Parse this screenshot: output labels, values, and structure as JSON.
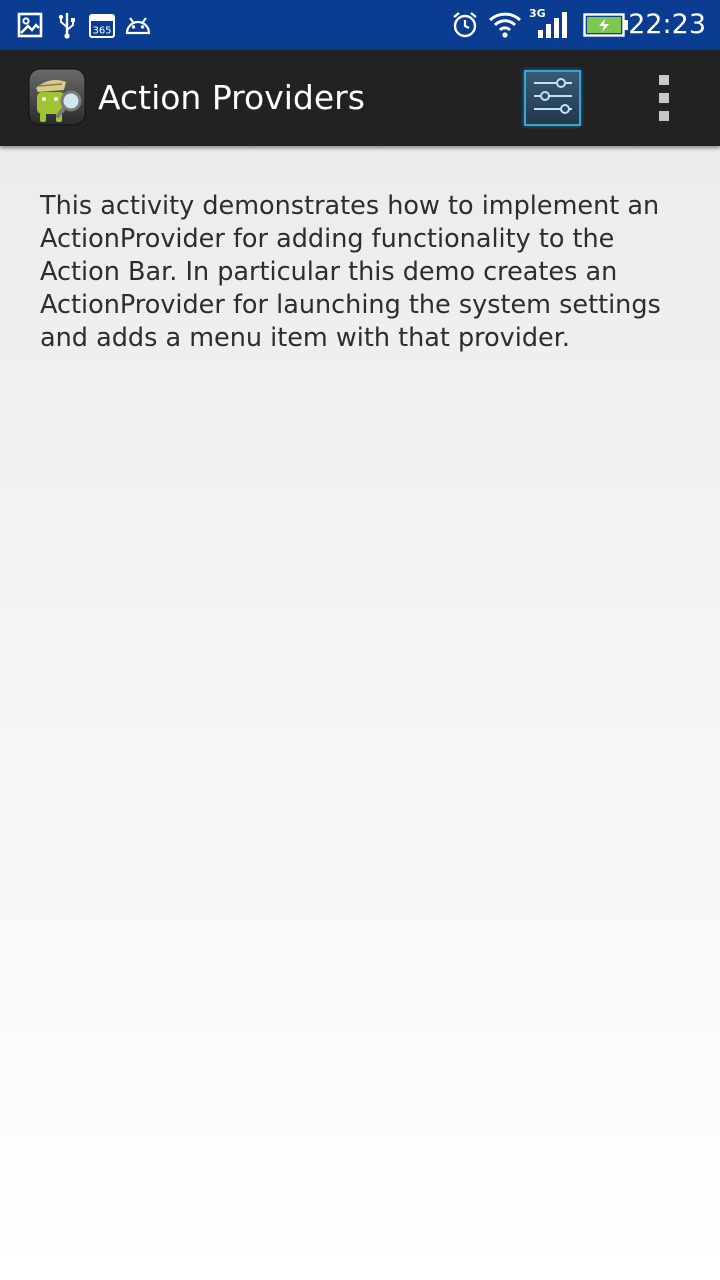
{
  "status_bar": {
    "time": "22:23",
    "network_type": "3G",
    "calendar_label": "365",
    "icons": {
      "left": [
        "image-notification-icon",
        "usb-icon",
        "calendar-icon",
        "android-debug-icon"
      ],
      "right": [
        "alarm-icon",
        "wifi-icon",
        "signal-icon",
        "battery-icon"
      ]
    }
  },
  "action_bar": {
    "title": "Action Providers",
    "app_icon": "api-demos-icon",
    "actions": [
      "settings-sliders-icon",
      "overflow-menu-icon"
    ]
  },
  "content": {
    "description": "This activity demonstrates how to implement an ActionProvider for adding functionality to the Action Bar. In particular this demo creates an ActionProvider for launching the system settings and adds a menu item with that provider."
  },
  "colors": {
    "status_bar": "#0a3d91",
    "action_bar": "#222222",
    "accent": "#33a7d8"
  }
}
